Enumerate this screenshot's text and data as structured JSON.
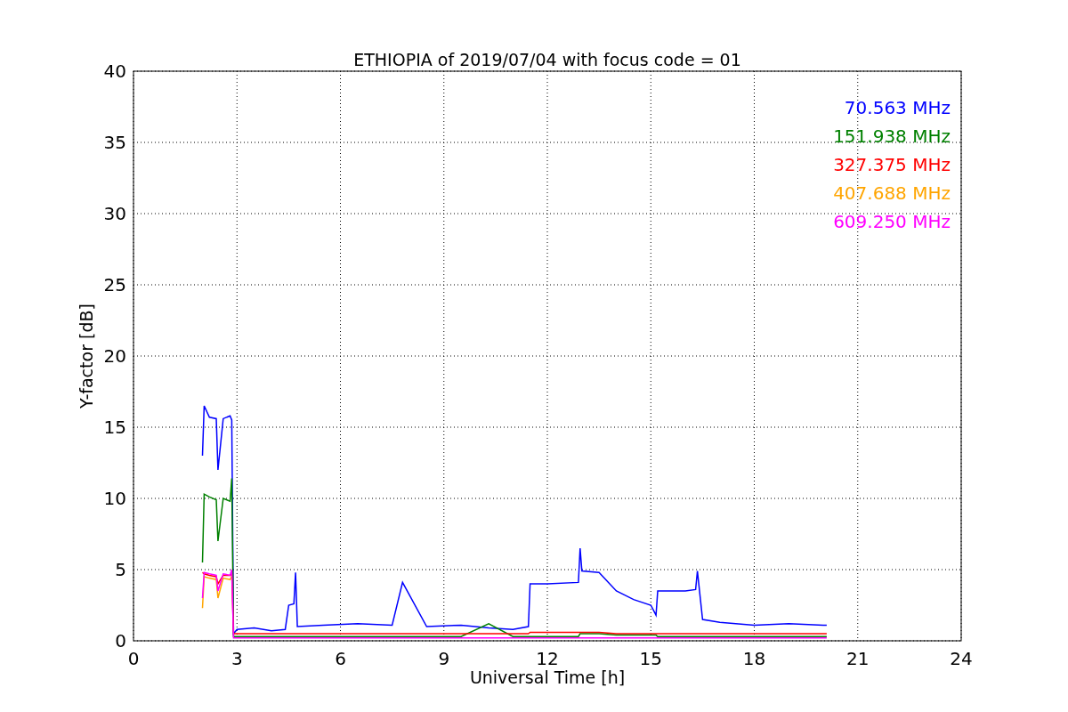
{
  "figure": {
    "chart_data": {
      "type": "line",
      "title": "ETHIOPIA of 2019/07/04 with focus code = 01",
      "xlabel": "Universal Time [h]",
      "ylabel": "Y-factor [dB]",
      "x": [
        2.0,
        2.05,
        2.2,
        2.4,
        2.45,
        2.6,
        2.8,
        2.85,
        2.9,
        3.0,
        3.5,
        4.0,
        4.4,
        4.5,
        4.65,
        4.7,
        4.75,
        5.5,
        6.5,
        7.5,
        7.8,
        8.5,
        9.5,
        10.3,
        11.0,
        11.45,
        11.5,
        12.0,
        12.9,
        12.95,
        13.0,
        13.5,
        14.0,
        14.5,
        15.0,
        15.15,
        15.2,
        16.0,
        16.3,
        16.35,
        16.5,
        17.0,
        18.0,
        19.0,
        20.0,
        20.1
      ],
      "series": [
        {
          "name": "70.563 MHz",
          "color": "#0000ff",
          "values": [
            13,
            16.5,
            15.7,
            15.6,
            12,
            15.6,
            15.8,
            15.5,
            0.5,
            0.8,
            0.9,
            0.7,
            0.8,
            2.5,
            2.6,
            4.8,
            1.0,
            1.1,
            1.2,
            1.1,
            4.1,
            1.0,
            1.1,
            0.9,
            0.8,
            1.0,
            4.0,
            4.0,
            4.1,
            6.5,
            4.9,
            4.8,
            3.5,
            2.9,
            2.5,
            1.8,
            3.5,
            3.5,
            3.6,
            4.9,
            1.5,
            1.3,
            1.1,
            1.2,
            1.1,
            1.1
          ]
        },
        {
          "name": "151.938 MHz",
          "color": "#008000",
          "values": [
            5.5,
            10.3,
            10.1,
            9.9,
            7,
            10.0,
            9.8,
            11.4,
            0.3,
            0.3,
            0.3,
            0.3,
            0.3,
            0.3,
            0.3,
            0.3,
            0.3,
            0.3,
            0.3,
            0.3,
            0.3,
            0.3,
            0.3,
            1.2,
            0.3,
            0.3,
            0.3,
            0.3,
            0.3,
            0.5,
            0.5,
            0.5,
            0.4,
            0.4,
            0.4,
            0.4,
            0.3,
            0.3,
            0.3,
            0.3,
            0.3,
            0.3,
            0.3,
            0.3,
            0.3,
            0.3
          ]
        },
        {
          "name": "327.375 MHz",
          "color": "#ff0000",
          "values": [
            4.8,
            4.7,
            4.6,
            4.5,
            4.0,
            4.6,
            4.6,
            4.7,
            0.5,
            0.5,
            0.5,
            0.5,
            0.5,
            0.5,
            0.5,
            0.5,
            0.5,
            0.5,
            0.5,
            0.5,
            0.5,
            0.5,
            0.5,
            0.5,
            0.5,
            0.5,
            0.6,
            0.6,
            0.6,
            0.6,
            0.6,
            0.6,
            0.5,
            0.5,
            0.5,
            0.5,
            0.5,
            0.5,
            0.5,
            0.5,
            0.5,
            0.5,
            0.5,
            0.5,
            0.5,
            0.5
          ]
        },
        {
          "name": "407.688 MHz",
          "color": "#ffa500",
          "values": [
            2.3,
            4.5,
            4.4,
            4.3,
            3.0,
            4.4,
            4.3,
            4.5,
            null,
            null,
            null,
            null,
            null,
            null,
            null,
            null,
            null,
            null,
            null,
            null,
            null,
            null,
            null,
            null,
            null,
            null,
            null,
            null,
            null,
            null,
            null,
            null,
            null,
            null,
            null,
            null,
            null,
            null,
            null,
            null,
            null,
            null,
            null,
            null,
            null,
            null
          ]
        },
        {
          "name": "609.250 MHz",
          "color": "#ff00ff",
          "values": [
            3.0,
            4.8,
            4.7,
            4.6,
            3.5,
            4.7,
            4.6,
            5.0,
            0.2,
            0.2,
            0.2,
            0.2,
            0.2,
            0.2,
            0.2,
            0.2,
            0.2,
            0.2,
            0.2,
            0.2,
            0.2,
            0.2,
            0.2,
            0.2,
            0.2,
            0.2,
            0.2,
            0.2,
            0.2,
            0.2,
            0.2,
            0.2,
            0.2,
            0.2,
            0.2,
            0.2,
            0.2,
            0.2,
            0.2,
            0.2,
            0.2,
            0.2,
            0.2,
            0.2,
            0.2,
            0.2
          ]
        }
      ],
      "grid": true,
      "xlim": [
        0,
        24
      ],
      "ylim": [
        0,
        40
      ],
      "xticks": [
        0,
        3,
        6,
        9,
        12,
        15,
        18,
        21,
        24
      ],
      "yticks": [
        0,
        5,
        10,
        15,
        20,
        25,
        30,
        35,
        40
      ]
    }
  }
}
